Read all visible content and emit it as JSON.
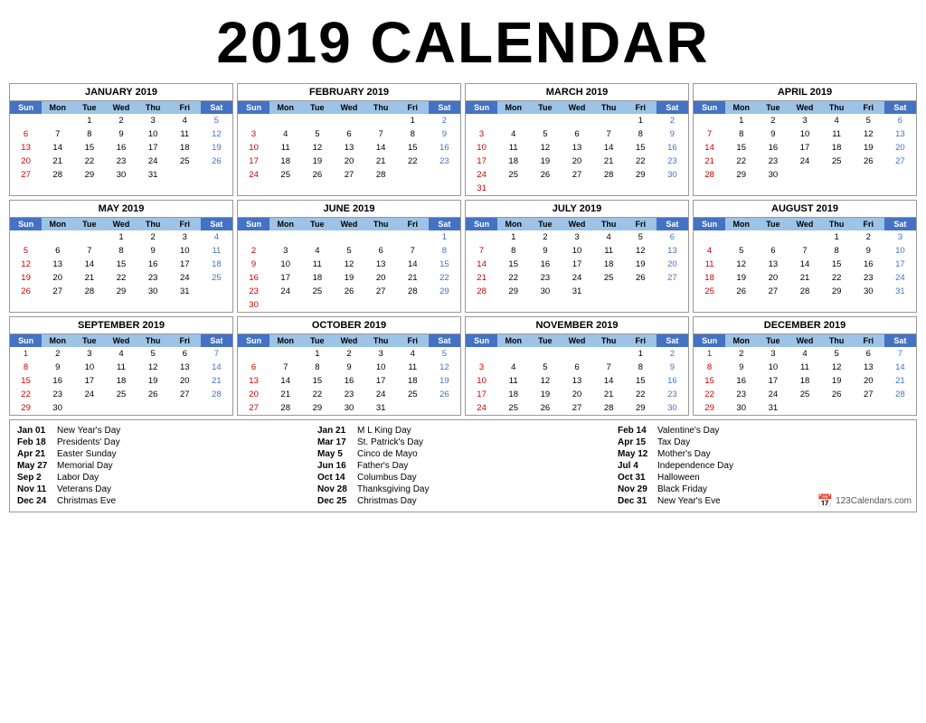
{
  "title": "2019 CALENDAR",
  "months": [
    {
      "name": "JANUARY 2019",
      "startDay": 2,
      "days": 31
    },
    {
      "name": "FEBRUARY 2019",
      "startDay": 5,
      "days": 28
    },
    {
      "name": "MARCH 2019",
      "startDay": 5,
      "days": 31
    },
    {
      "name": "APRIL 2019",
      "startDay": 1,
      "days": 30
    },
    {
      "name": "MAY 2019",
      "startDay": 3,
      "days": 31
    },
    {
      "name": "JUNE 2019",
      "startDay": 6,
      "days": 30
    },
    {
      "name": "JULY 2019",
      "startDay": 1,
      "days": 31
    },
    {
      "name": "AUGUST 2019",
      "startDay": 4,
      "days": 31
    },
    {
      "name": "SEPTEMBER 2019",
      "startDay": 0,
      "days": 30
    },
    {
      "name": "OCTOBER 2019",
      "startDay": 2,
      "days": 31
    },
    {
      "name": "NOVEMBER 2019",
      "startDay": 5,
      "days": 30
    },
    {
      "name": "DECEMBER 2019",
      "startDay": 0,
      "days": 31
    }
  ],
  "dayHeaders": [
    "Sun",
    "Mon",
    "Tue",
    "Wed",
    "Thu",
    "Fri",
    "Sat"
  ],
  "holidays": {
    "col1": [
      {
        "date": "Jan 01",
        "name": "New Year's Day"
      },
      {
        "date": "Feb 18",
        "name": "Presidents' Day"
      },
      {
        "date": "Apr 21",
        "name": "Easter Sunday"
      },
      {
        "date": "May 27",
        "name": "Memorial Day"
      },
      {
        "date": "Sep 2",
        "name": "Labor Day"
      },
      {
        "date": "Nov 11",
        "name": "Veterans Day"
      },
      {
        "date": "Dec 24",
        "name": "Christmas Eve"
      }
    ],
    "col2": [
      {
        "date": "Jan 21",
        "name": "M L King Day"
      },
      {
        "date": "Mar 17",
        "name": "St. Patrick's Day"
      },
      {
        "date": "May 5",
        "name": "Cinco de Mayo"
      },
      {
        "date": "Jun 16",
        "name": "Father's Day"
      },
      {
        "date": "Oct 14",
        "name": "Columbus Day"
      },
      {
        "date": "Nov 28",
        "name": "Thanksgiving Day"
      },
      {
        "date": "Dec 25",
        "name": "Christmas Day"
      }
    ],
    "col3": [
      {
        "date": "Feb 14",
        "name": "Valentine's Day"
      },
      {
        "date": "Apr 15",
        "name": "Tax Day"
      },
      {
        "date": "May 12",
        "name": "Mother's Day"
      },
      {
        "date": "Jul 4",
        "name": "Independence Day"
      },
      {
        "date": "Oct 31",
        "name": "Halloween"
      },
      {
        "date": "Nov 29",
        "name": "Black Friday"
      },
      {
        "date": "Dec 31",
        "name": "New Year's Eve"
      }
    ]
  },
  "branding": "123Calendars.com"
}
